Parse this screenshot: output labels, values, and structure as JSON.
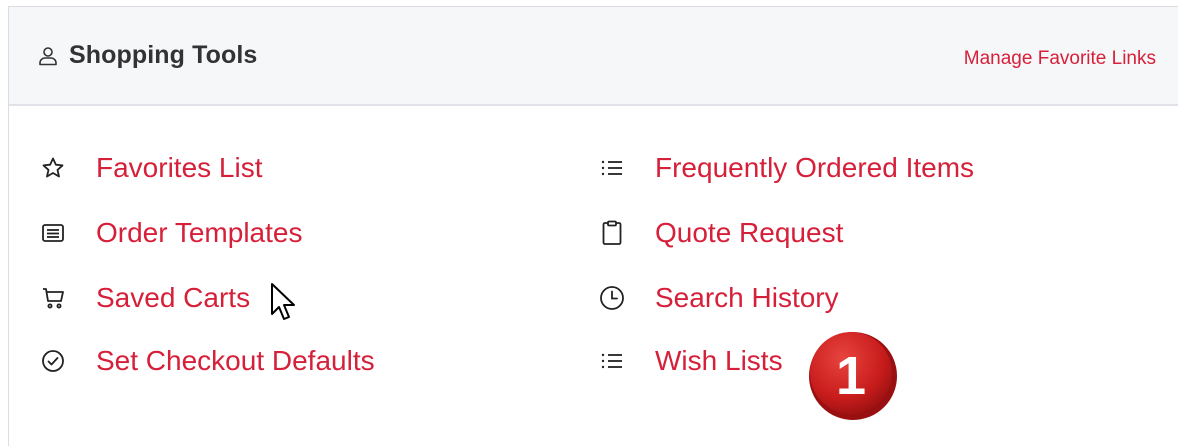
{
  "header": {
    "title": "Shopping Tools",
    "manage_link": "Manage Favorite Links"
  },
  "links": {
    "left": [
      {
        "label": "Favorites List",
        "icon": "star-icon"
      },
      {
        "label": "Order Templates",
        "icon": "list-box-icon"
      },
      {
        "label": "Saved Carts",
        "icon": "cart-icon"
      },
      {
        "label": "Set Checkout Defaults",
        "icon": "check-circle-icon"
      }
    ],
    "right": [
      {
        "label": "Frequently Ordered Items",
        "icon": "list-icon"
      },
      {
        "label": "Quote Request",
        "icon": "clipboard-icon"
      },
      {
        "label": "Search History",
        "icon": "clock-icon"
      },
      {
        "label": "Wish Lists",
        "icon": "list-icon"
      }
    ]
  },
  "annotation": {
    "badge_number": "1"
  },
  "colors": {
    "link": "#d6203a",
    "header_bg": "#f6f7f9",
    "badge": "#cc1f1f"
  }
}
